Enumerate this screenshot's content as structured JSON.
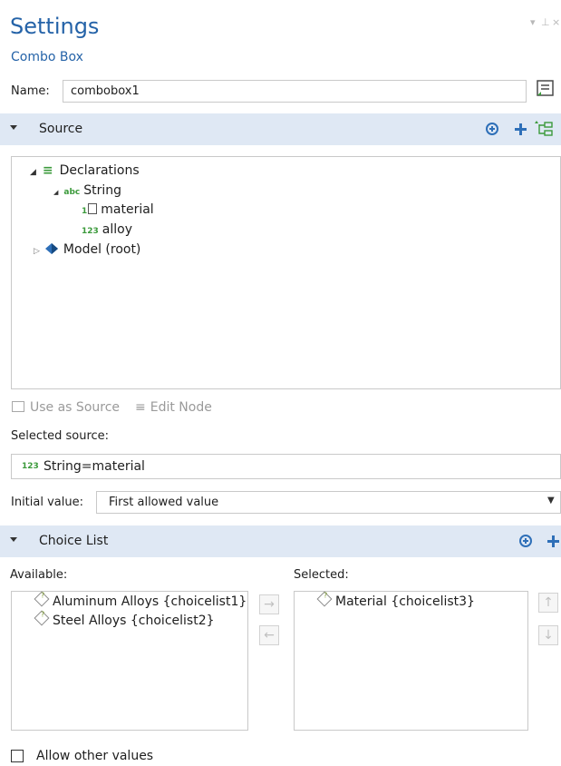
{
  "panel": {
    "title": "Settings",
    "subtitle": "Combo Box"
  },
  "name_row": {
    "label": "Name:",
    "value": "combobox1"
  },
  "source": {
    "section_title": "Source",
    "tree": [
      {
        "label": "Declarations"
      },
      {
        "badge": "abc",
        "label": "String"
      },
      {
        "badge": "1",
        "label": "material"
      },
      {
        "badge": "123",
        "label": "alloy"
      },
      {
        "label": "Model (root)"
      }
    ],
    "use_as_source": "Use as Source",
    "edit_node": "Edit Node",
    "selected_source_label": "Selected source:",
    "selected_source_badge": "123",
    "selected_source_value": "String=material",
    "initial_value_label": "Initial value:",
    "initial_value": "First allowed value"
  },
  "choice_list": {
    "section_title": "Choice List",
    "available_label": "Available:",
    "selected_label": "Selected:",
    "available_items": [
      "Aluminum Alloys {choicelist1}",
      "Steel Alloys {choicelist2}"
    ],
    "selected_items": [
      "Material {choicelist3}"
    ]
  },
  "allow_other_values": {
    "label": "Allow other values",
    "checked": false
  },
  "colors": {
    "accent": "#2563a8",
    "section_bg": "#dfe8f4",
    "badge_green": "#3b9a3b"
  }
}
